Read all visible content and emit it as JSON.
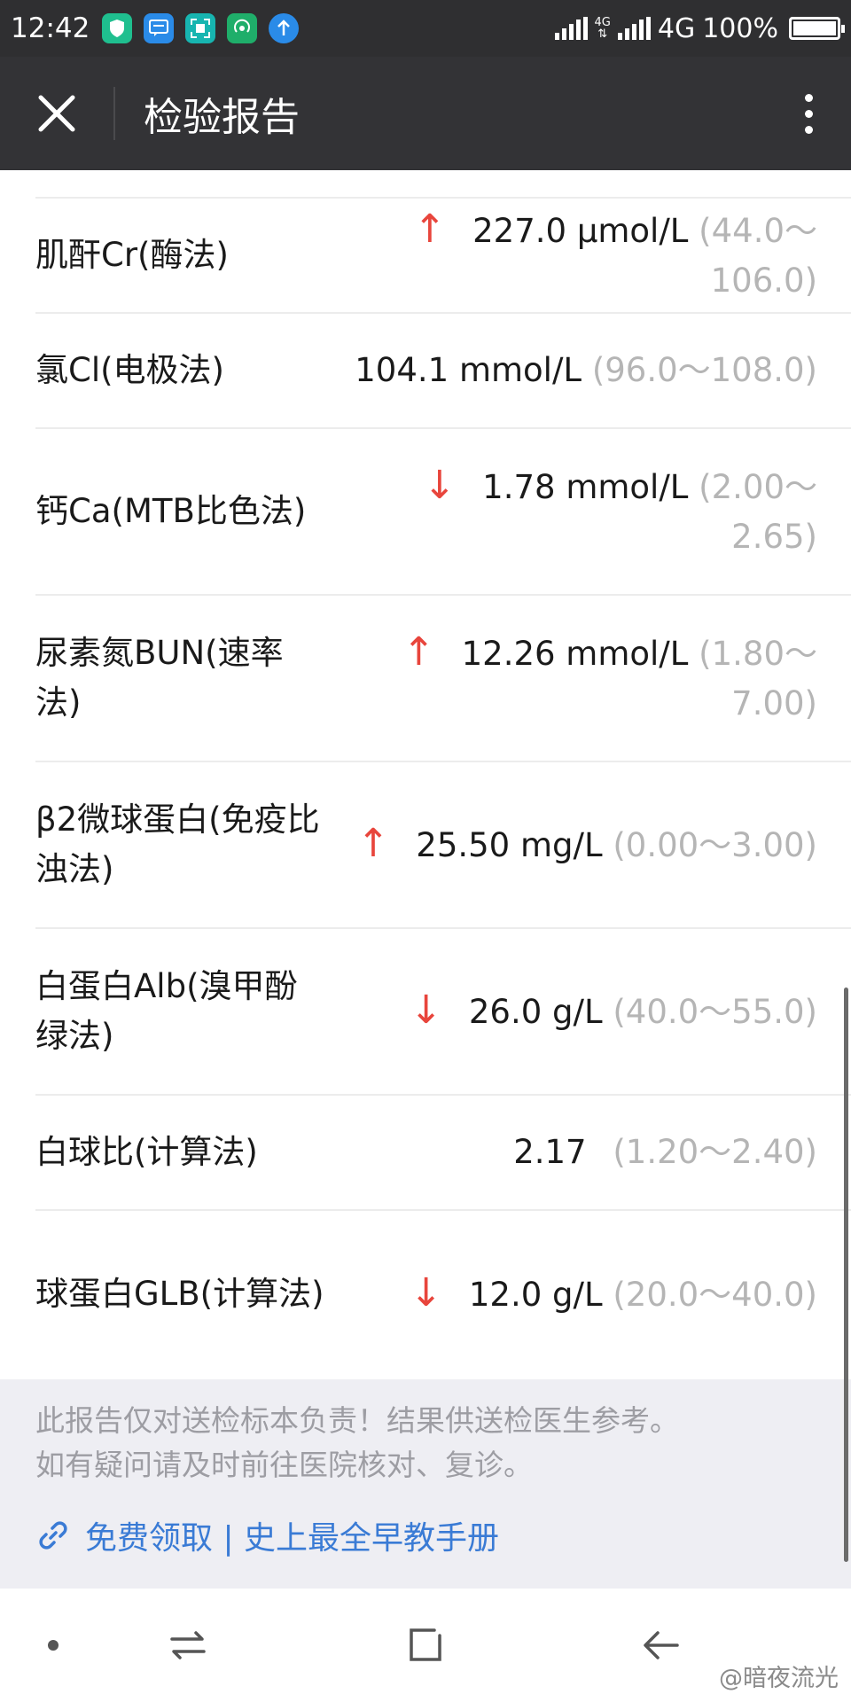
{
  "status_bar": {
    "time": "12:42",
    "notification_icons": [
      "shield-icon",
      "message-icon",
      "scan-icon",
      "hotspot-icon",
      "upload-icon"
    ],
    "signal1_net": "4G",
    "signal2_net": "4G",
    "battery": "100%"
  },
  "header": {
    "title": "检验报告"
  },
  "results": [
    {
      "name": "肌酐Cr(酶法)",
      "flag": "up",
      "arrow": "↑",
      "value": "227.0 μmol/L",
      "range": "(44.0～106.0)"
    },
    {
      "name": "氯Cl(电极法)",
      "flag": "none",
      "arrow": "",
      "value": "104.1 mmol/L",
      "range": "(96.0～108.0)"
    },
    {
      "name": "钙Ca(MTB比色法)",
      "flag": "down",
      "arrow": "↓",
      "value": "1.78 mmol/L",
      "range": "(2.00～2.65)"
    },
    {
      "name": "尿素氮BUN(速率法)",
      "flag": "up",
      "arrow": "↑",
      "value": "12.26 mmol/L",
      "range": "(1.80～7.00)"
    },
    {
      "name": "β2微球蛋白(免疫比浊法)",
      "flag": "up",
      "arrow": "↑",
      "value": "25.50 mg/L",
      "range": "(0.00～3.00)"
    },
    {
      "name": "白蛋白Alb(溴甲酚绿法)",
      "flag": "down",
      "arrow": "↓",
      "value": "26.0 g/L",
      "range": "(40.0～55.0)"
    },
    {
      "name": "白球比(计算法)",
      "flag": "none",
      "arrow": "",
      "value": "2.17",
      "range": "(1.20～2.40)"
    },
    {
      "name": "球蛋白GLB(计算法)",
      "flag": "down",
      "arrow": "↓",
      "value": "12.0 g/L",
      "range": "(20.0～40.0)"
    }
  ],
  "notice": {
    "line1": "此报告仅对送检标本负责！结果供送检医生参考。",
    "line2": "如有疑问请及时前往医院核对、复诊。",
    "promo": "免费领取 | 史上最全早教手册"
  },
  "watermark": "@暗夜流光",
  "colors": {
    "header_bg": "#333336",
    "abnormal_arrow": "#e8453c",
    "link": "#3a7bd5",
    "range_text": "#b5b5b5"
  }
}
